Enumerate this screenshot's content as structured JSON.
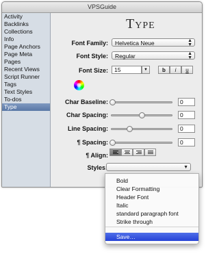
{
  "window": {
    "title": "VPSGuide"
  },
  "sidebar": {
    "items": [
      {
        "label": "Activity"
      },
      {
        "label": "Backlinks"
      },
      {
        "label": "Collections"
      },
      {
        "label": "Info"
      },
      {
        "label": "Page Anchors"
      },
      {
        "label": "Page Meta"
      },
      {
        "label": "Pages"
      },
      {
        "label": "Recent Views"
      },
      {
        "label": "Script Runner"
      },
      {
        "label": "Tags"
      },
      {
        "label": "Text Styles"
      },
      {
        "label": "To-dos"
      },
      {
        "label": "Type"
      }
    ],
    "selected": "Type"
  },
  "panel": {
    "title": "Type",
    "font_family": {
      "label": "Font Family:",
      "value": "Helvetica Neue"
    },
    "font_style": {
      "label": "Font Style:",
      "value": "Regular"
    },
    "font_size": {
      "label": "Font Size:",
      "value": "15"
    },
    "format_buttons": {
      "bold": "b",
      "italic": "i",
      "underline": "u"
    },
    "color_wheel_icon": "color-wheel-icon",
    "sliders": [
      {
        "label": "Char Baseline:",
        "value": "0",
        "level": 0.0
      },
      {
        "label": "Char Spacing:",
        "value": "0",
        "level": 0.5
      },
      {
        "label": "Line Spacing:",
        "value": "0",
        "level": 0.3
      },
      {
        "label": "¶ Spacing:",
        "value": "0",
        "level": 0.0
      }
    ],
    "align": {
      "label": "¶ Align:",
      "selected": "left"
    },
    "styles": {
      "label": "Styles:",
      "value": ""
    }
  },
  "styles_menu": {
    "items": [
      "Bold",
      "Clear Formatting",
      "Header Font",
      "Italic",
      "standard paragraph font",
      "Strike through"
    ],
    "save_item": "Save…"
  },
  "colors": {
    "selection": "#5977a6",
    "menu_highlight": "#2542d6"
  }
}
